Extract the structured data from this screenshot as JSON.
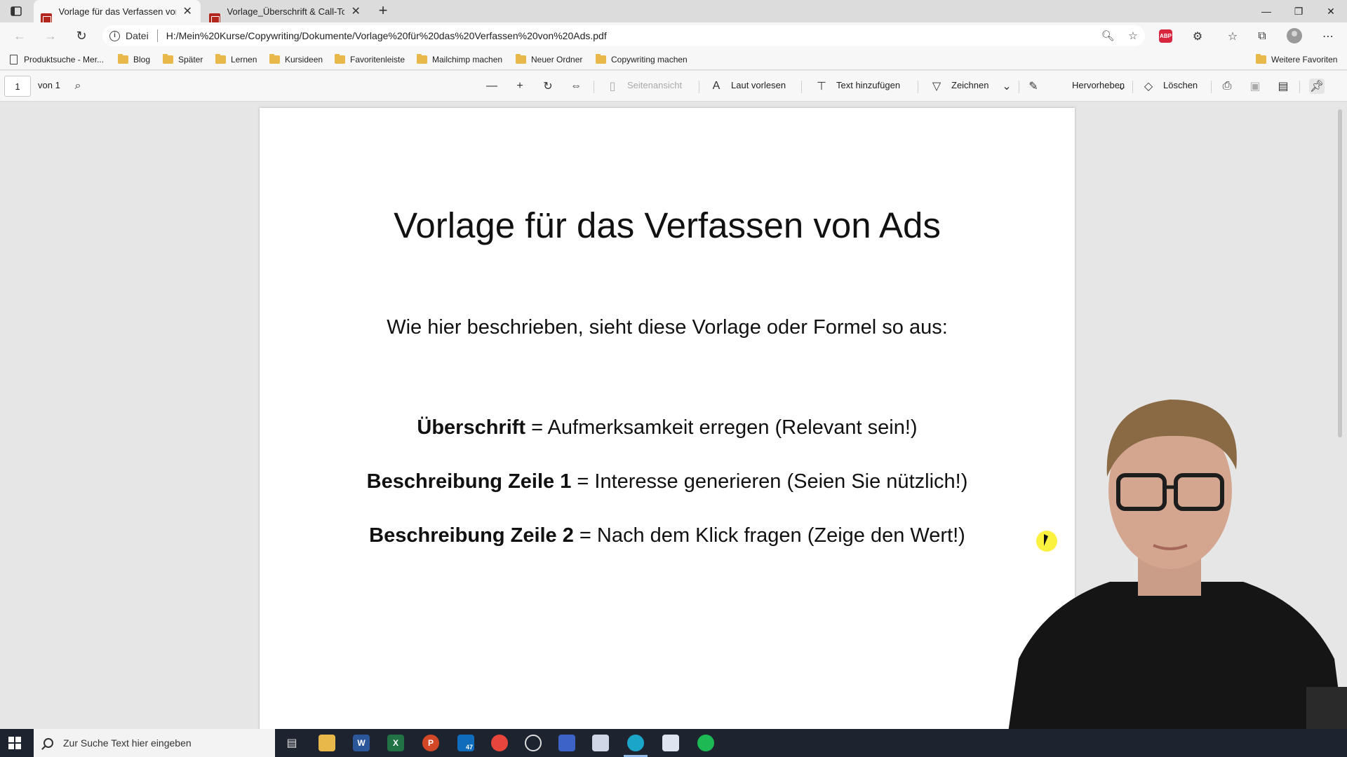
{
  "browser": {
    "tabs": [
      {
        "title": "Vorlage für das Verfassen von Ads",
        "active": true
      },
      {
        "title": "Vorlage_Überschrift & Call-To-Action",
        "active": false
      }
    ],
    "address": {
      "scheme_label": "Datei",
      "url": "H:/Mein%20Kurse/Copywriting/Dokumente/Vorlage%20für%20das%20Verfassen%20von%20Ads.pdf"
    },
    "abp_label": "ABP",
    "bookmarks": [
      "Produktsuche - Mer...",
      "Blog",
      "Später",
      "Lernen",
      "Kursideen",
      "Favoritenleiste",
      "Mailchimp machen",
      "Neuer Ordner",
      "Copywriting machen"
    ],
    "other_favorites": "Weitere Favoriten"
  },
  "pdf_toolbar": {
    "page_number": "1",
    "page_total": "von 1",
    "page_view": "Seitenansicht",
    "read_aloud": "Laut vorlesen",
    "add_text": "Text hinzufügen",
    "draw": "Zeichnen",
    "highlight": "Hervorheben",
    "erase": "Löschen"
  },
  "document": {
    "title": "Vorlage für das Verfassen von Ads",
    "intro": "Wie hier beschrieben, sieht diese Vorlage oder Formel so aus:",
    "lines": [
      {
        "label": "Überschrift",
        "text": " = Aufmerksamkeit erregen (Relevant sein!)"
      },
      {
        "label": "Beschreibung Zeile 1",
        "text": " = Interesse generieren (Seien Sie nützlich!)"
      },
      {
        "label": "Beschreibung Zeile 2",
        "text": " = Nach dem Klick fragen (Zeige den Wert!)"
      }
    ]
  },
  "taskbar": {
    "search_placeholder": "Zur Suche Text hier eingeben",
    "mail_badge": "47"
  },
  "colors": {
    "accent_pdf": "#b3261e",
    "taskbar": "#1d2430",
    "cursor_highlight": "#f5ea1e"
  }
}
